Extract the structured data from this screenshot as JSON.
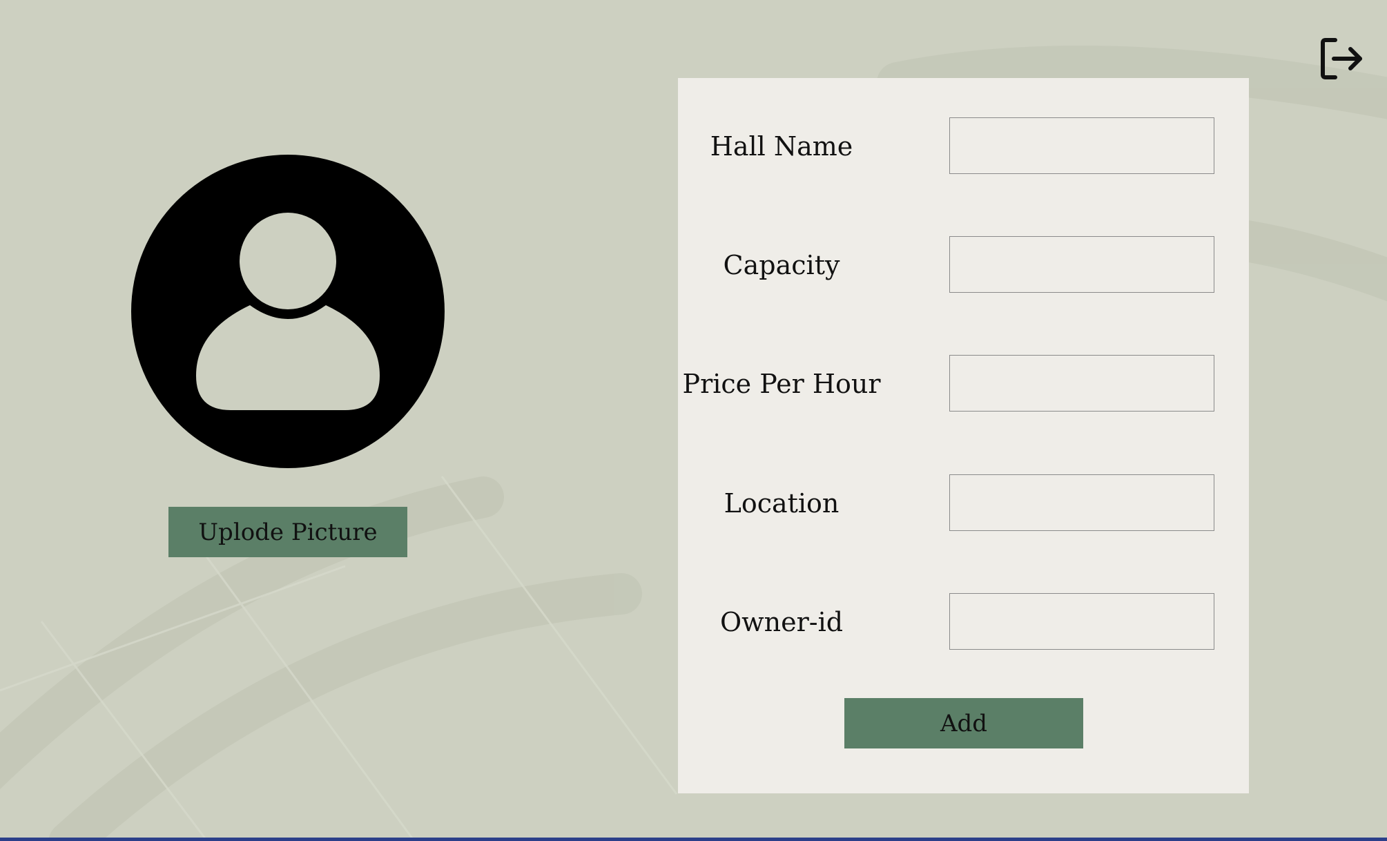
{
  "header": {
    "logout_icon": "logout-icon"
  },
  "profile": {
    "avatar_icon": "user-avatar-icon",
    "upload_label": "Uplode Picture"
  },
  "form": {
    "fields": [
      {
        "label": "Hall Name",
        "value": "",
        "placeholder": ""
      },
      {
        "label": "Capacity",
        "value": "",
        "placeholder": ""
      },
      {
        "label": "Price Per Hour",
        "value": "",
        "placeholder": ""
      },
      {
        "label": "Location",
        "value": "",
        "placeholder": ""
      },
      {
        "label": "Owner-id",
        "value": "",
        "placeholder": ""
      }
    ],
    "submit_label": "Add"
  },
  "colors": {
    "background": "#cdd0c1",
    "panel": "#efede8",
    "button": "#5b7f67",
    "bottom_bar": "#2b3f8a"
  }
}
